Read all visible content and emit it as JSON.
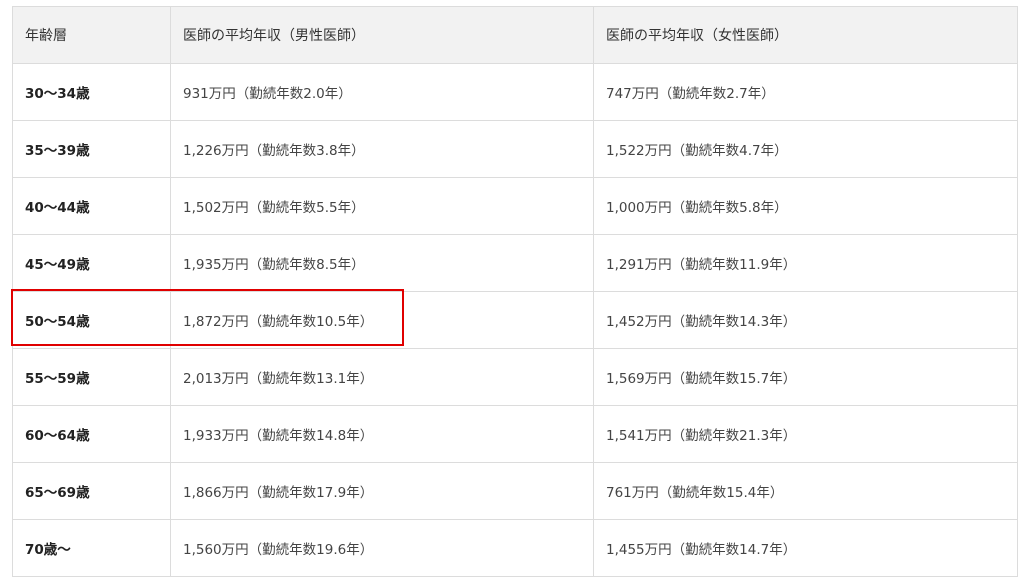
{
  "table": {
    "headers": {
      "age": "年齢層",
      "male": "医師の平均年収（男性医師）",
      "female": "医師の平均年収（女性医師）"
    },
    "rows": [
      {
        "age": "30〜34歳",
        "male": "931万円（勤続年数2.0年）",
        "female": "747万円（勤続年数2.7年）"
      },
      {
        "age": "35〜39歳",
        "male": "1,226万円（勤続年数3.8年）",
        "female": "1,522万円（勤続年数4.7年）"
      },
      {
        "age": "40〜44歳",
        "male": "1,502万円（勤続年数5.5年）",
        "female": "1,000万円（勤続年数5.8年）"
      },
      {
        "age": "45〜49歳",
        "male": "1,935万円（勤続年数8.5年）",
        "female": "1,291万円（勤続年数11.9年）"
      },
      {
        "age": "50〜54歳",
        "male": "1,872万円（勤続年数10.5年）",
        "female": "1,452万円（勤続年数14.3年）"
      },
      {
        "age": "55〜59歳",
        "male": "2,013万円（勤続年数13.1年）",
        "female": "1,569万円（勤続年数15.7年）"
      },
      {
        "age": "60〜64歳",
        "male": "1,933万円（勤続年数14.8年）",
        "female": "1,541万円（勤続年数21.3年）"
      },
      {
        "age": "65〜69歳",
        "male": "1,866万円（勤続年数17.9年）",
        "female": "761万円（勤続年数15.4年）"
      },
      {
        "age": "70歳〜",
        "male": "1,560万円（勤続年数19.6年）",
        "female": "1,455万円（勤続年数14.7年）"
      }
    ],
    "highlight_color": "#e00000",
    "highlighted_row": 4
  }
}
